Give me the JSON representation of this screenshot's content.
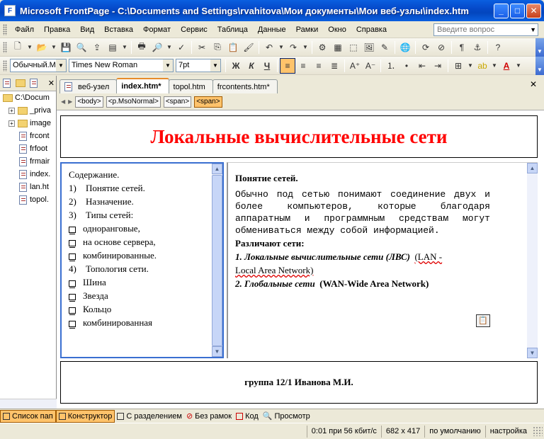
{
  "window": {
    "title": "Microsoft FrontPage - C:\\Documents and Settings\\rvahitova\\Мои документы\\Мои веб-узлы\\index.htm",
    "app_icon": "frontpage-icon"
  },
  "menu": {
    "items": [
      "Файл",
      "Правка",
      "Вид",
      "Вставка",
      "Формат",
      "Сервис",
      "Таблица",
      "Данные",
      "Рамки",
      "Окно",
      "Справка"
    ],
    "help_placeholder": "Введите вопрос"
  },
  "format_toolbar": {
    "style": "Обычный.M",
    "font": "Times New Roman",
    "size": "7pt",
    "bold": "Ж",
    "italic": "К",
    "underline": "Ч"
  },
  "folder_list": {
    "rows": [
      {
        "label": "C:\\Docum",
        "type": "root"
      },
      {
        "label": "_priva",
        "type": "folder"
      },
      {
        "label": "image",
        "type": "folder"
      },
      {
        "label": "frcont",
        "type": "file"
      },
      {
        "label": "frfoot",
        "type": "file"
      },
      {
        "label": "frmair",
        "type": "file"
      },
      {
        "label": "index.",
        "type": "file"
      },
      {
        "label": "lan.ht",
        "type": "file"
      },
      {
        "label": "topol.",
        "type": "file"
      }
    ]
  },
  "tabs": [
    {
      "label": "веб-узел",
      "active": false
    },
    {
      "label": "index.htm*",
      "active": true
    },
    {
      "label": "topol.htm",
      "active": false
    },
    {
      "label": "frcontents.htm*",
      "active": false
    }
  ],
  "tag_selector": [
    "<body>",
    "<p.MsoNormal>",
    "<span>",
    "<span>"
  ],
  "page": {
    "banner_title": "Локальные вычислительные сети",
    "contents": {
      "heading": "Содержание.",
      "items": [
        {
          "marker": "1)",
          "text": "Понятие сетей.",
          "kind": "num"
        },
        {
          "marker": "2)",
          "text": "Назначение.",
          "kind": "num"
        },
        {
          "marker": "3)",
          "text": "Типы сетей:",
          "kind": "num"
        },
        {
          "marker": "",
          "text": "одноранговые,",
          "kind": "bullet"
        },
        {
          "marker": "",
          "text": "на основе сервера,",
          "kind": "bullet"
        },
        {
          "marker": "",
          "text": "комбинированные.",
          "kind": "bullet"
        },
        {
          "marker": "4)",
          "text": "Топология сети.",
          "kind": "num"
        },
        {
          "marker": "",
          "text": "Шина",
          "kind": "bullet"
        },
        {
          "marker": "",
          "text": "Звезда",
          "kind": "bullet"
        },
        {
          "marker": "",
          "text": "Кольцо",
          "kind": "bullet"
        },
        {
          "marker": "",
          "text": "комбинированная",
          "kind": "bullet"
        }
      ]
    },
    "main": {
      "heading": "Понятие сетей.",
      "paragraph": "Обычно под сетью понимают соединение двух и более компьютеров, которые благодаря аппаратным и программным средствам могут обмениваться между собой информацией.",
      "subheading": "Различают сети:",
      "item1_label": "1. Локальные вычислительные сети (ЛВС)",
      "item1_abbr_a": "(LAN -",
      "item1_abbr_b": "Local Area Network)",
      "item2_label": "2. Глобальные сети",
      "item2_abbr": "(WAN-Wide Area Network)"
    },
    "footer_text": "группа 12/1 Иванова М.И."
  },
  "view_bar": [
    {
      "label": "Список пап",
      "active": true
    },
    {
      "label": "Конструктор",
      "active": true
    },
    {
      "label": "С разделением",
      "active": false
    },
    {
      "label": "Без рамок",
      "active": false
    },
    {
      "label": "Код",
      "active": false
    },
    {
      "label": "Просмотр",
      "active": false
    }
  ],
  "status": {
    "speed": "0:01 при 56 кбит/с",
    "dimensions": "682 x 417",
    "mode": "по умолчанию",
    "settings": "настройка"
  }
}
